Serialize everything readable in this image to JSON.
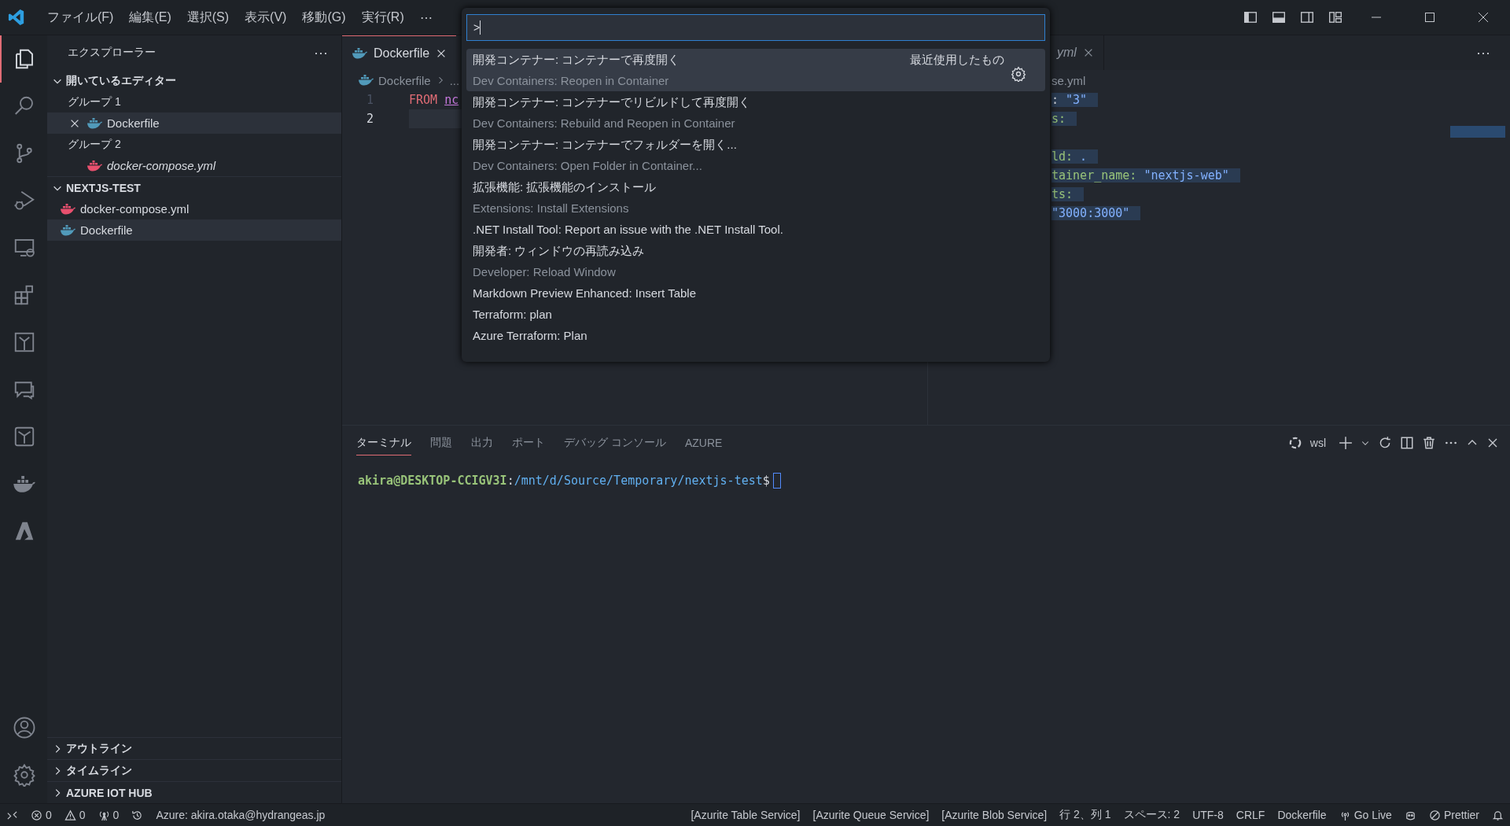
{
  "menu": [
    "ファイル(F)",
    "編集(E)",
    "選択(S)",
    "表示(V)",
    "移動(G)",
    "実行(R)",
    "⋯"
  ],
  "activity_bar": {
    "top": [
      {
        "kind": "files",
        "selected": true
      },
      {
        "kind": "search",
        "selected": false
      },
      {
        "kind": "source-control",
        "selected": false
      },
      {
        "kind": "run-debug",
        "selected": false
      },
      {
        "kind": "remote",
        "selected": false
      },
      {
        "kind": "extensions",
        "selected": false
      },
      {
        "kind": "tree-box",
        "selected": false
      },
      {
        "kind": "comments",
        "selected": false
      },
      {
        "kind": "tree",
        "selected": false
      },
      {
        "kind": "docker",
        "selected": false
      },
      {
        "kind": "azure",
        "selected": false
      }
    ],
    "bottom": [
      {
        "kind": "account"
      },
      {
        "kind": "settings"
      }
    ]
  },
  "sidebar": {
    "title": "エクスプローラー",
    "more": "⋯",
    "open_editors": {
      "title": "開いているエディター",
      "expanded": true,
      "groups": [
        {
          "label": "グループ 1",
          "files": [
            {
              "name": "Dockerfile",
              "kind": "dockerfile",
              "preview": false,
              "selected": true
            }
          ]
        },
        {
          "label": "グループ 2",
          "files": [
            {
              "name": "docker-compose.yml",
              "kind": "compose",
              "preview": true,
              "selected": false
            }
          ]
        }
      ]
    },
    "folder": {
      "title": "NEXTJS-TEST",
      "expanded": true,
      "files": [
        {
          "name": "docker-compose.yml",
          "kind": "compose",
          "selected": false
        },
        {
          "name": "Dockerfile",
          "kind": "dockerfile",
          "selected": true
        }
      ]
    },
    "collapsed_sections": [
      {
        "title": "アウトライン",
        "expanded": false
      },
      {
        "title": "タイムライン",
        "expanded": false
      },
      {
        "title": "AZURE IOT HUB",
        "expanded": false
      }
    ]
  },
  "left_editor": {
    "tab": {
      "name": "Dockerfile",
      "kind": "dockerfile"
    },
    "breadcrumb": [
      "Dockerfile",
      "..."
    ],
    "lines": [
      {
        "number": "1",
        "current": false,
        "tokens": [
          {
            "text": "FROM",
            "kind": "keyword"
          },
          {
            "text": "nc",
            "kind": "image"
          }
        ]
      },
      {
        "number": "2",
        "current": true
      }
    ]
  },
  "right_editor": {
    "tab": "yml",
    "more": "⋯",
    "breadcrumb": "se.yml",
    "lines": [
      {
        "selected": true,
        "tokens": [
          {
            "text": ": ",
            "kind": "punct"
          },
          {
            "text": "\"3\"",
            "kind": "string"
          }
        ]
      },
      {
        "selected": true,
        "tokens": [
          {
            "text": "s:",
            "kind": "key"
          }
        ]
      },
      {
        "selected": false
      },
      {
        "selected": true,
        "tokens": [
          {
            "text": "ld:",
            "kind": "key"
          },
          {
            "text": " .",
            "kind": "string"
          }
        ]
      },
      {
        "selected": true,
        "tokens": [
          {
            "text": "tainer_name:",
            "kind": "key"
          },
          {
            "text": " \"nextjs-web\"",
            "kind": "string"
          }
        ]
      },
      {
        "selected": true,
        "tokens": [
          {
            "text": "ts:",
            "kind": "key"
          }
        ]
      },
      {
        "selected": true,
        "tokens": [
          {
            "text": "  \"3000:3000\"",
            "kind": "string"
          }
        ]
      }
    ]
  },
  "command_palette": {
    "value": ">",
    "items": [
      {
        "title": "開発コンテナー: コンテナーで再度開く",
        "subtitle": "Dev Containers: Reopen in Container",
        "tag": "最近使用したもの",
        "selected": true
      },
      {
        "title": "開発コンテナー: コンテナーでリビルドして再度開く",
        "subtitle": "Dev Containers: Rebuild and Reopen in Container",
        "selected": false
      },
      {
        "title": "開発コンテナー: コンテナーでフォルダーを開く...",
        "subtitle": "Dev Containers: Open Folder in Container...",
        "selected": false
      },
      {
        "title": "拡張機能: 拡張機能のインストール",
        "subtitle": "Extensions: Install Extensions",
        "selected": false
      },
      {
        "title": ".NET Install Tool: Report an issue with the .NET Install Tool.",
        "selected": false
      },
      {
        "title": "開発者: ウィンドウの再読み込み",
        "subtitle": "Developer: Reload Window",
        "selected": false
      },
      {
        "title": "Markdown Preview Enhanced: Insert Table",
        "selected": false
      },
      {
        "title": "Terraform: plan",
        "selected": false
      },
      {
        "title": "Azure Terraform: Plan",
        "selected": false
      }
    ]
  },
  "panel": {
    "tabs": [
      {
        "label": "ターミナル",
        "selected": true
      },
      {
        "label": "問題",
        "selected": false
      },
      {
        "label": "出力",
        "selected": false
      },
      {
        "label": "ポート",
        "selected": false
      },
      {
        "label": "デバッグ コンソール",
        "selected": false
      },
      {
        "label": "AZURE",
        "selected": false
      }
    ],
    "shell": "wsl",
    "prompt": {
      "user": "akira@DESKTOP-CCIGV3I",
      "sep": ":",
      "path": "/mnt/d/Source/Temporary/nextjs-test",
      "symbol": "$"
    }
  },
  "status_bar": {
    "left": [
      {
        "kind": "remote"
      },
      {
        "kind": "errors",
        "text": "0"
      },
      {
        "kind": "warnings",
        "text": "0"
      },
      {
        "kind": "ports",
        "text": "0"
      },
      {
        "kind": "history"
      },
      {
        "kind": "text",
        "text": "Azure: akira.otaka@hydrangeas.jp"
      }
    ],
    "right": [
      {
        "kind": "text",
        "text": "[Azurite Table Service]"
      },
      {
        "kind": "text",
        "text": "[Azurite Queue Service]"
      },
      {
        "kind": "text",
        "text": "[Azurite Blob Service]"
      },
      {
        "kind": "text",
        "text": "行 2、列 1"
      },
      {
        "kind": "text",
        "text": "スペース: 2"
      },
      {
        "kind": "text",
        "text": "UTF-8"
      },
      {
        "kind": "text",
        "text": "CRLF"
      },
      {
        "kind": "text",
        "text": "Dockerfile"
      },
      {
        "kind": "golive",
        "text": "Go Live"
      },
      {
        "kind": "copilot"
      },
      {
        "kind": "prettier",
        "text": "Prettier"
      },
      {
        "kind": "bell"
      }
    ]
  }
}
